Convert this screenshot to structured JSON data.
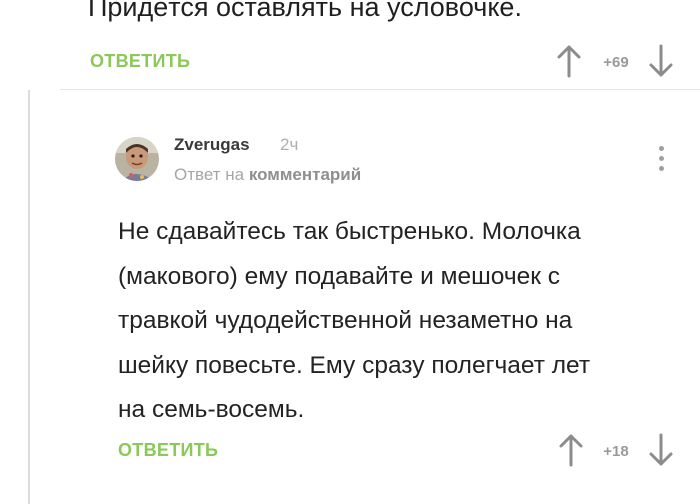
{
  "previous_comment": {
    "text_tail": "Придётся оставлять на условочке.",
    "reply_label": "ОТВЕТИТЬ",
    "score": "+69"
  },
  "comment": {
    "author": "Zverugas",
    "time": "2ч",
    "reply_prefix": "Ответ на",
    "reply_target": "комментарий",
    "body_lines": [
      "Не сдавайтесь так быстренько. Молочка",
      "(макового) ему подавайте и мешочек с",
      "травкой чудодейственной незаметно на",
      "шейку повесьте. Ему сразу полегчает лет",
      "на семь-восемь."
    ],
    "reply_label": "ОТВЕТИТЬ",
    "score": "+18"
  },
  "colors": {
    "accent_green": "#8ac858",
    "muted_gray": "#9a9a9a"
  },
  "icons": [
    "arrow-up-icon",
    "arrow-down-icon",
    "more-vertical-icon",
    "avatar"
  ]
}
